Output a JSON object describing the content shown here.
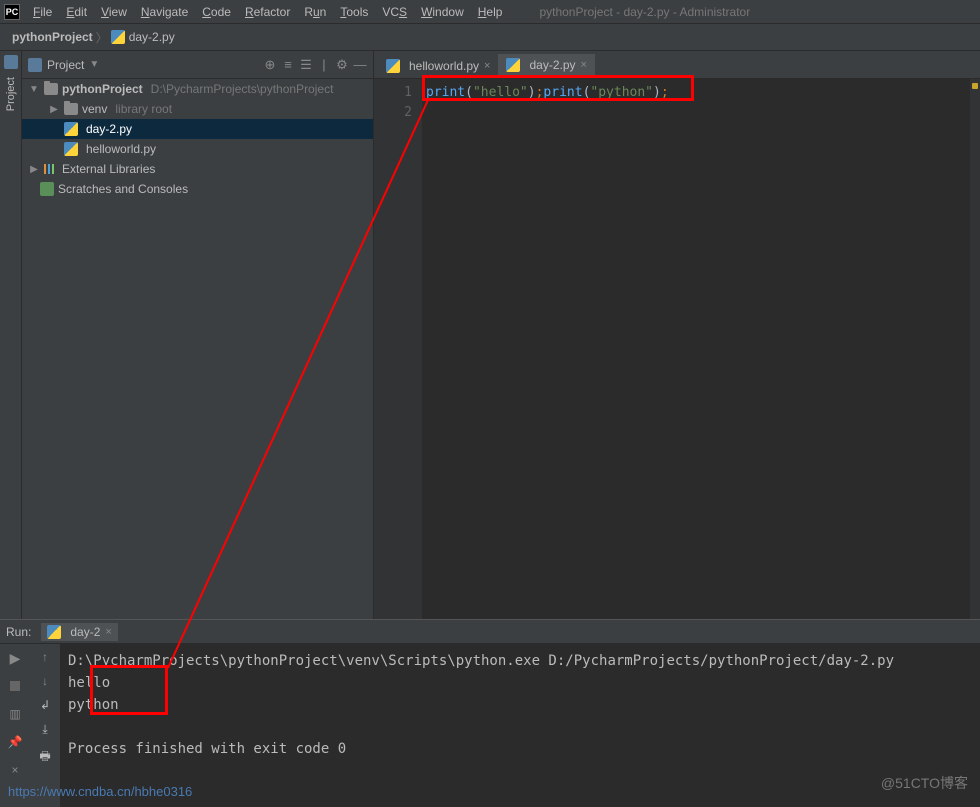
{
  "window_title": "pythonProject - day-2.py - Administrator",
  "menubar": [
    "File",
    "Edit",
    "View",
    "Navigate",
    "Code",
    "Refactor",
    "Run",
    "Tools",
    "VCS",
    "Window",
    "Help"
  ],
  "breadcrumb": {
    "root": "pythonProject",
    "file": "day-2.py"
  },
  "project_panel": {
    "title": "Project",
    "tree": {
      "root": {
        "name": "pythonProject",
        "path": "D:\\PycharmProjects\\pythonProject"
      },
      "venv": {
        "name": "venv",
        "hint": "library root"
      },
      "file1": "day-2.py",
      "file2": "helloworld.py",
      "ext_lib": "External Libraries",
      "scratches": "Scratches and Consoles"
    }
  },
  "editor": {
    "tabs": [
      {
        "label": "helloworld.py",
        "active": false
      },
      {
        "label": "day-2.py",
        "active": true
      }
    ],
    "line_numbers": [
      "1",
      "2"
    ],
    "code": {
      "fn1": "print",
      "lp1": "(",
      "s1": "\"hello\"",
      "rp1": ")",
      "semi": ";",
      "fn2": "print",
      "lp2": "(",
      "s2": "\"python\"",
      "rp2": ")",
      "semi2": ";"
    }
  },
  "run": {
    "label": "Run:",
    "tab": "day-2",
    "console": {
      "cmd": "D:\\PycharmProjects\\pythonProject\\venv\\Scripts\\python.exe D:/PycharmProjects/pythonProject/day-2.py",
      "out1": "hello",
      "out2": "python",
      "exit": "Process finished with exit code 0"
    }
  },
  "watermark_bl": "https://www.cndba.cn/hbhe0316",
  "watermark_br": "@51CTO博客",
  "sidebar_label": "Project"
}
